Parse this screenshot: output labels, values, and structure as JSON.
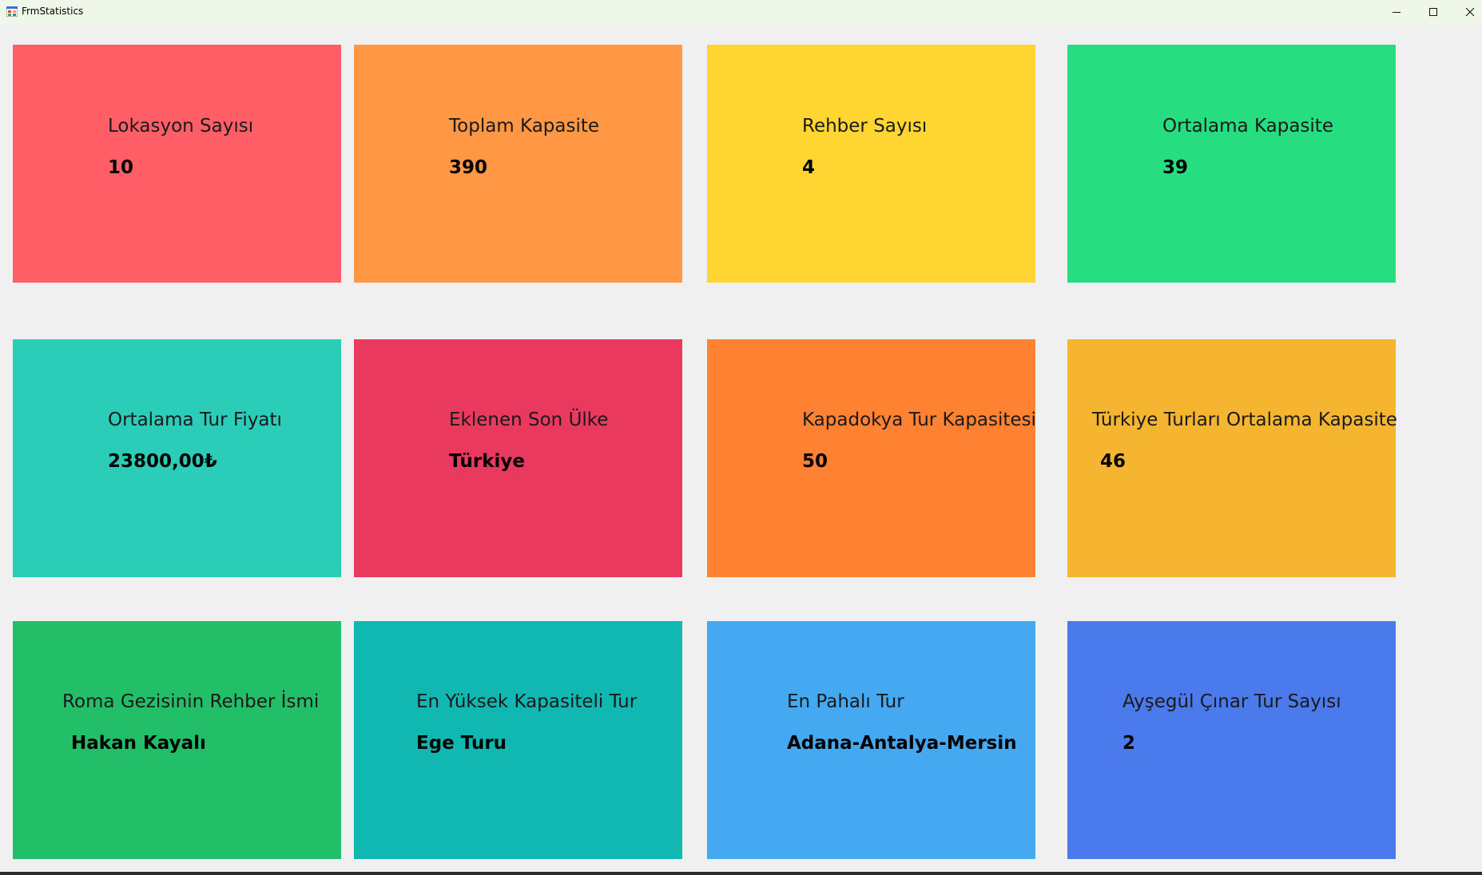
{
  "window": {
    "title": "FrmStatistics"
  },
  "cards": [
    {
      "label": "Lokasyon Sayısı",
      "value": "10",
      "color": "#ff5e66"
    },
    {
      "label": "Toplam Kapasite",
      "value": "390",
      "color": "#ff9744"
    },
    {
      "label": "Rehber Sayısı",
      "value": "4",
      "color": "#ffd531"
    },
    {
      "label": "Ortalama Kapasite",
      "value": "39",
      "color": "#26dd7f"
    },
    {
      "label": "Ortalama Tur Fiyatı",
      "value": "23800,00₺",
      "color": "#2bccb8"
    },
    {
      "label": "Eklenen Son Ülke",
      "value": "Türkiye",
      "color": "#ea395e"
    },
    {
      "label": "Kapadokya Tur Kapasitesi",
      "value": "50",
      "color": "#ff8233"
    },
    {
      "label": "Türkiye Turları Ortalama Kapasite",
      "value": "46",
      "color": "#f6b531"
    },
    {
      "label": "Roma Gezisinin Rehber İsmi",
      "value": "Hakan Kayalı",
      "color": "#22bf68"
    },
    {
      "label": "En Yüksek Kapasiteli Tur",
      "value": "Ege Turu",
      "color": "#11b8b2"
    },
    {
      "label": "En Pahalı Tur",
      "value": "Adana-Antalya-Mersin",
      "color": "#45a9f2"
    },
    {
      "label": "Ayşegül Çınar Tur Sayısı",
      "value": "2",
      "color": "#4b7aec"
    }
  ]
}
